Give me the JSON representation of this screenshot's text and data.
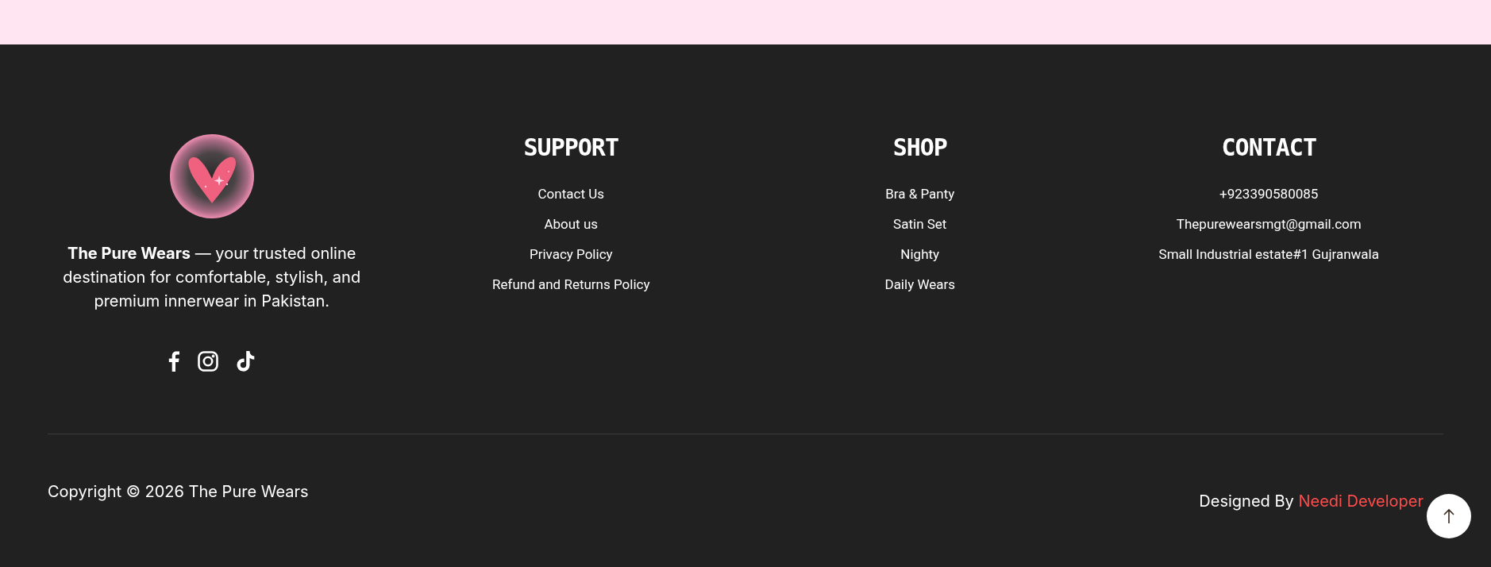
{
  "brand": {
    "description": "**The Pure Wears** — your trusted online destination for comfortable, stylish, and premium innerwear in Pakistan."
  },
  "social_links": [
    {
      "kind": "facebook"
    },
    {
      "kind": "instagram"
    },
    {
      "kind": "tiktok"
    }
  ],
  "columns": [
    {
      "title": "SUPPORT",
      "links": [
        "Contact Us",
        "About us",
        "Privacy Policy",
        "Refund and Returns Policy"
      ]
    },
    {
      "title": "SHOP",
      "links": [
        "Bra & Panty",
        "Satin Set",
        "Nighty",
        "Daily Wears"
      ]
    },
    {
      "title": "CONTACT",
      "links": [
        "+923390580085",
        "Thepurewearsmgt@gmail.com",
        "Small Industrial estate#1 Gujranwala"
      ]
    }
  ],
  "copyright": "Copyright © 2026 The Pure Wears",
  "credit": {
    "prefix": "Designed By",
    "link": "Needi Developer"
  }
}
